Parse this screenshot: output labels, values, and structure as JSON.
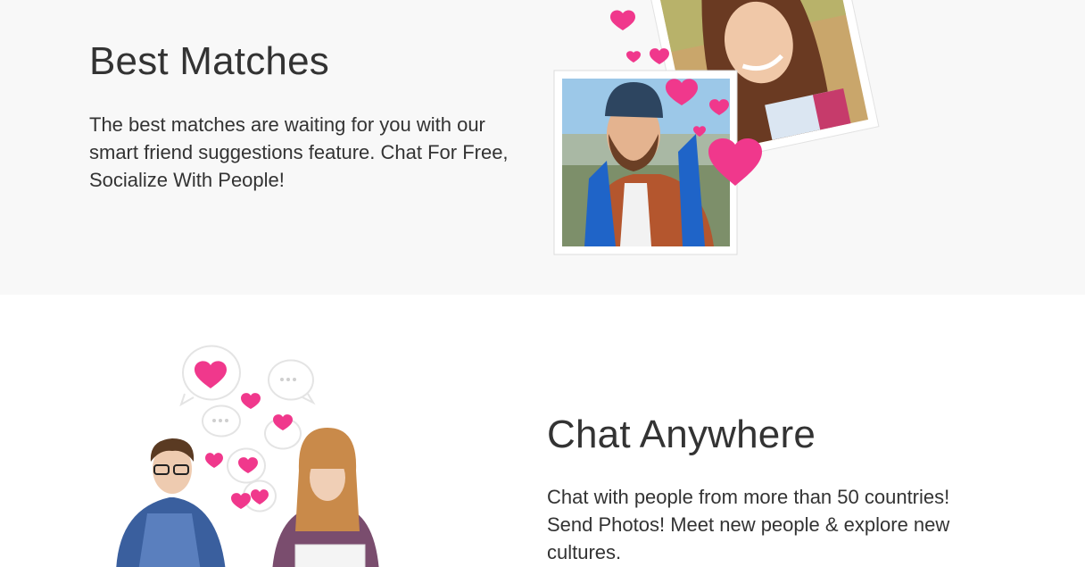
{
  "best_matches": {
    "title": "Best Matches",
    "description": "The best matches are waiting for you with our smart friend suggestions feature. Chat For Free, Socialize With People!"
  },
  "chat_anywhere": {
    "title": "Chat Anywhere",
    "description": "Chat with people from more than 50 countries! Send Photos! Meet new people & explore new cultures."
  },
  "colors": {
    "heart_pink": "#f0388c",
    "section_gray": "#f8f8f8",
    "text": "#333333"
  }
}
